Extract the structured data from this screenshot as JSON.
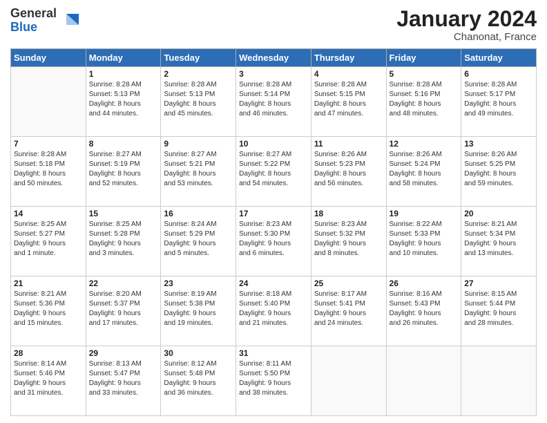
{
  "logo": {
    "general": "General",
    "blue": "Blue"
  },
  "title": "January 2024",
  "location": "Chanonat, France",
  "days_header": [
    "Sunday",
    "Monday",
    "Tuesday",
    "Wednesday",
    "Thursday",
    "Friday",
    "Saturday"
  ],
  "weeks": [
    [
      {
        "day": "",
        "info": ""
      },
      {
        "day": "1",
        "info": "Sunrise: 8:28 AM\nSunset: 5:13 PM\nDaylight: 8 hours\nand 44 minutes."
      },
      {
        "day": "2",
        "info": "Sunrise: 8:28 AM\nSunset: 5:13 PM\nDaylight: 8 hours\nand 45 minutes."
      },
      {
        "day": "3",
        "info": "Sunrise: 8:28 AM\nSunset: 5:14 PM\nDaylight: 8 hours\nand 46 minutes."
      },
      {
        "day": "4",
        "info": "Sunrise: 8:28 AM\nSunset: 5:15 PM\nDaylight: 8 hours\nand 47 minutes."
      },
      {
        "day": "5",
        "info": "Sunrise: 8:28 AM\nSunset: 5:16 PM\nDaylight: 8 hours\nand 48 minutes."
      },
      {
        "day": "6",
        "info": "Sunrise: 8:28 AM\nSunset: 5:17 PM\nDaylight: 8 hours\nand 49 minutes."
      }
    ],
    [
      {
        "day": "7",
        "info": "Sunrise: 8:28 AM\nSunset: 5:18 PM\nDaylight: 8 hours\nand 50 minutes."
      },
      {
        "day": "8",
        "info": "Sunrise: 8:27 AM\nSunset: 5:19 PM\nDaylight: 8 hours\nand 52 minutes."
      },
      {
        "day": "9",
        "info": "Sunrise: 8:27 AM\nSunset: 5:21 PM\nDaylight: 8 hours\nand 53 minutes."
      },
      {
        "day": "10",
        "info": "Sunrise: 8:27 AM\nSunset: 5:22 PM\nDaylight: 8 hours\nand 54 minutes."
      },
      {
        "day": "11",
        "info": "Sunrise: 8:26 AM\nSunset: 5:23 PM\nDaylight: 8 hours\nand 56 minutes."
      },
      {
        "day": "12",
        "info": "Sunrise: 8:26 AM\nSunset: 5:24 PM\nDaylight: 8 hours\nand 58 minutes."
      },
      {
        "day": "13",
        "info": "Sunrise: 8:26 AM\nSunset: 5:25 PM\nDaylight: 8 hours\nand 59 minutes."
      }
    ],
    [
      {
        "day": "14",
        "info": "Sunrise: 8:25 AM\nSunset: 5:27 PM\nDaylight: 9 hours\nand 1 minute."
      },
      {
        "day": "15",
        "info": "Sunrise: 8:25 AM\nSunset: 5:28 PM\nDaylight: 9 hours\nand 3 minutes."
      },
      {
        "day": "16",
        "info": "Sunrise: 8:24 AM\nSunset: 5:29 PM\nDaylight: 9 hours\nand 5 minutes."
      },
      {
        "day": "17",
        "info": "Sunrise: 8:23 AM\nSunset: 5:30 PM\nDaylight: 9 hours\nand 6 minutes."
      },
      {
        "day": "18",
        "info": "Sunrise: 8:23 AM\nSunset: 5:32 PM\nDaylight: 9 hours\nand 8 minutes."
      },
      {
        "day": "19",
        "info": "Sunrise: 8:22 AM\nSunset: 5:33 PM\nDaylight: 9 hours\nand 10 minutes."
      },
      {
        "day": "20",
        "info": "Sunrise: 8:21 AM\nSunset: 5:34 PM\nDaylight: 9 hours\nand 13 minutes."
      }
    ],
    [
      {
        "day": "21",
        "info": "Sunrise: 8:21 AM\nSunset: 5:36 PM\nDaylight: 9 hours\nand 15 minutes."
      },
      {
        "day": "22",
        "info": "Sunrise: 8:20 AM\nSunset: 5:37 PM\nDaylight: 9 hours\nand 17 minutes."
      },
      {
        "day": "23",
        "info": "Sunrise: 8:19 AM\nSunset: 5:38 PM\nDaylight: 9 hours\nand 19 minutes."
      },
      {
        "day": "24",
        "info": "Sunrise: 8:18 AM\nSunset: 5:40 PM\nDaylight: 9 hours\nand 21 minutes."
      },
      {
        "day": "25",
        "info": "Sunrise: 8:17 AM\nSunset: 5:41 PM\nDaylight: 9 hours\nand 24 minutes."
      },
      {
        "day": "26",
        "info": "Sunrise: 8:16 AM\nSunset: 5:43 PM\nDaylight: 9 hours\nand 26 minutes."
      },
      {
        "day": "27",
        "info": "Sunrise: 8:15 AM\nSunset: 5:44 PM\nDaylight: 9 hours\nand 28 minutes."
      }
    ],
    [
      {
        "day": "28",
        "info": "Sunrise: 8:14 AM\nSunset: 5:46 PM\nDaylight: 9 hours\nand 31 minutes."
      },
      {
        "day": "29",
        "info": "Sunrise: 8:13 AM\nSunset: 5:47 PM\nDaylight: 9 hours\nand 33 minutes."
      },
      {
        "day": "30",
        "info": "Sunrise: 8:12 AM\nSunset: 5:48 PM\nDaylight: 9 hours\nand 36 minutes."
      },
      {
        "day": "31",
        "info": "Sunrise: 8:11 AM\nSunset: 5:50 PM\nDaylight: 9 hours\nand 38 minutes."
      },
      {
        "day": "",
        "info": ""
      },
      {
        "day": "",
        "info": ""
      },
      {
        "day": "",
        "info": ""
      }
    ]
  ]
}
